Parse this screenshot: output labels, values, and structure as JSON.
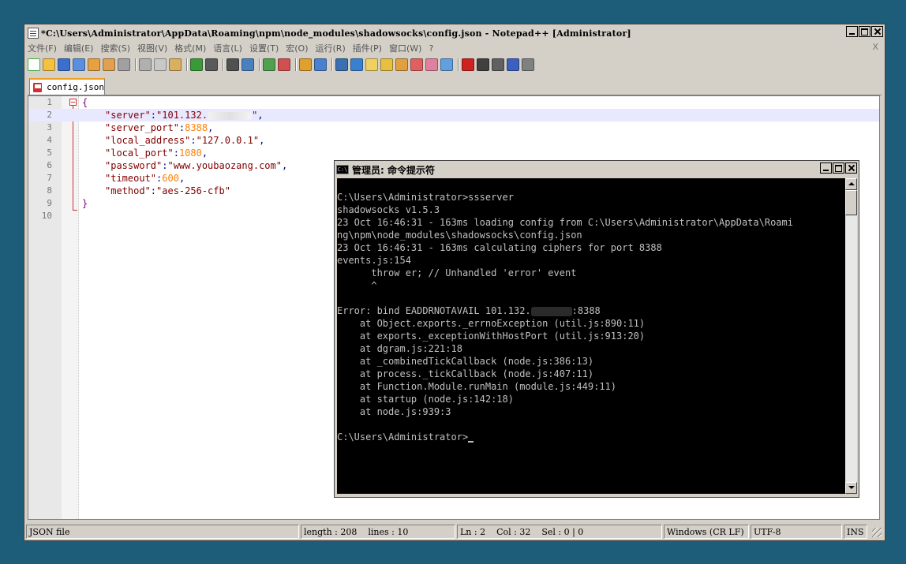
{
  "notepad": {
    "title": "*C:\\Users\\Administrator\\AppData\\Roaming\\npm\\node_modules\\shadowsocks\\config.json - Notepad++ [Administrator]",
    "menu": [
      "文件(F)",
      "编辑(E)",
      "搜索(S)",
      "视图(V)",
      "格式(M)",
      "语言(L)",
      "设置(T)",
      "宏(O)",
      "运行(R)",
      "插件(P)",
      "窗口(W)",
      "?"
    ],
    "menu_close": "X",
    "toolbar_icons": [
      "new-file-icon",
      "open-file-icon",
      "save-icon",
      "save-all-icon",
      "close-icon",
      "close-all-icon",
      "print-icon",
      "cut-icon",
      "copy-icon",
      "paste-icon",
      "undo-icon",
      "redo-icon",
      "find-icon",
      "replace-icon",
      "zoom-in-icon",
      "zoom-out-icon",
      "sync-vertical-icon",
      "sync-horizontal-icon",
      "word-wrap-icon",
      "show-all-chars-icon",
      "indent-guide-icon",
      "doc-map-icon",
      "function-list-icon",
      "folder-workspace-icon",
      "monitoring-icon",
      "eye-icon",
      "record-macro-icon",
      "stop-macro-icon",
      "play-macro-icon",
      "run-macro-multiple-icon",
      "save-macro-icon"
    ],
    "tab_label": "config.json",
    "line_numbers": [
      "1",
      "2",
      "3",
      "4",
      "5",
      "6",
      "7",
      "8",
      "9",
      "10"
    ],
    "code": {
      "open_brace": "{",
      "server_key": "\"server\"",
      "server_val_start": "\"101.132.",
      "server_val_end": "\"",
      "server_port_key": "\"server_port\"",
      "server_port_val": "8388",
      "local_address_key": "\"local_address\"",
      "local_address_val": "\"127.0.0.1\"",
      "local_port_key": "\"local_port\"",
      "local_port_val": "1080",
      "password_key": "\"password\"",
      "password_val": "\"www.youbaozang.com\"",
      "timeout_key": "\"timeout\"",
      "timeout_val": "600",
      "method_key": "\"method\"",
      "method_val": "\"aes-256-cfb\"",
      "close_brace": "}"
    },
    "status": {
      "file_type": "JSON file",
      "length": "length : 208    lines : 10",
      "position": "Ln : 2    Col : 32    Sel : 0 | 0",
      "eol": "Windows (CR LF)",
      "encoding": "UTF-8",
      "mode": "INS"
    }
  },
  "cmd": {
    "title": "管理员: 命令提示符",
    "icon_text": "C:\\",
    "lines": {
      "l1": "",
      "l2": "C:\\Users\\Administrator>ssserver",
      "l3": "shadowsocks v1.5.3",
      "l4": "23 Oct 16:46:31 - 163ms loading config from C:\\Users\\Administrator\\AppData\\Roami",
      "l5": "ng\\npm\\node_modules\\shadowsocks\\config.json",
      "l6": "23 Oct 16:46:31 - 163ms calculating ciphers for port 8388",
      "l7": "events.js:154",
      "l8": "      throw er; // Unhandled 'error' event",
      "l9": "      ^",
      "l10": "",
      "l11a": "Error: bind EADDRNOTAVAIL 101.132.",
      "l11b": ":8388",
      "l12": "    at Object.exports._errnoException (util.js:890:11)",
      "l13": "    at exports._exceptionWithHostPort (util.js:913:20)",
      "l14": "    at dgram.js:221:18",
      "l15": "    at _combinedTickCallback (node.js:386:13)",
      "l16": "    at process._tickCallback (node.js:407:11)",
      "l17": "    at Function.Module.runMain (module.js:449:11)",
      "l18": "    at startup (node.js:142:18)",
      "l19": "    at node.js:939:3",
      "l20": "",
      "l21": "C:\\Users\\Administrator>"
    }
  },
  "colors": {
    "desktop": "#1d5d7a",
    "string": "#800000",
    "number": "#ff8000",
    "brace": "#800080",
    "current_line": "#e8e8ff"
  }
}
